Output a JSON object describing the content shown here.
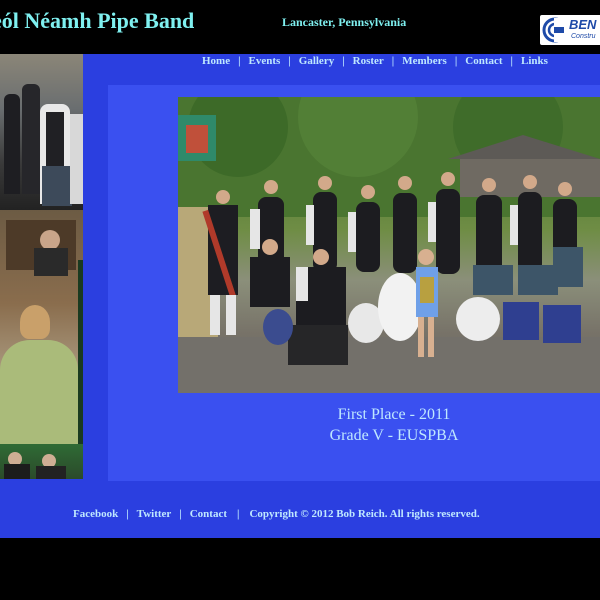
{
  "header": {
    "site_title": "eól Néamh Pipe Band",
    "location": "Lancaster, Pennsylvania",
    "sponsor": {
      "name": "BEN",
      "subtext": "Constru"
    }
  },
  "nav": [
    {
      "label": "Home"
    },
    {
      "label": "Events"
    },
    {
      "label": "Gallery"
    },
    {
      "label": "Roster"
    },
    {
      "label": "Members"
    },
    {
      "label": "Contact"
    },
    {
      "label": "Links"
    }
  ],
  "nav_separator": "|",
  "main": {
    "caption_line1": "First Place - 2011",
    "caption_line2": "Grade V - EUSPBA"
  },
  "footer": {
    "links": [
      {
        "label": "Facebook"
      },
      {
        "label": "Twitter"
      },
      {
        "label": "Contact"
      }
    ],
    "separator": "|",
    "copyright": "Copyright © 2012 Bob Reich. All rights reserved."
  },
  "colors": {
    "background": "#000000",
    "page_blue": "#2b3fe0",
    "panel_blue": "#3a50f0",
    "title_cyan": "#7ff0f0",
    "link_light": "#bfe8ff"
  },
  "icons": {
    "sponsor_logo": "sponsor-logo-icon"
  }
}
